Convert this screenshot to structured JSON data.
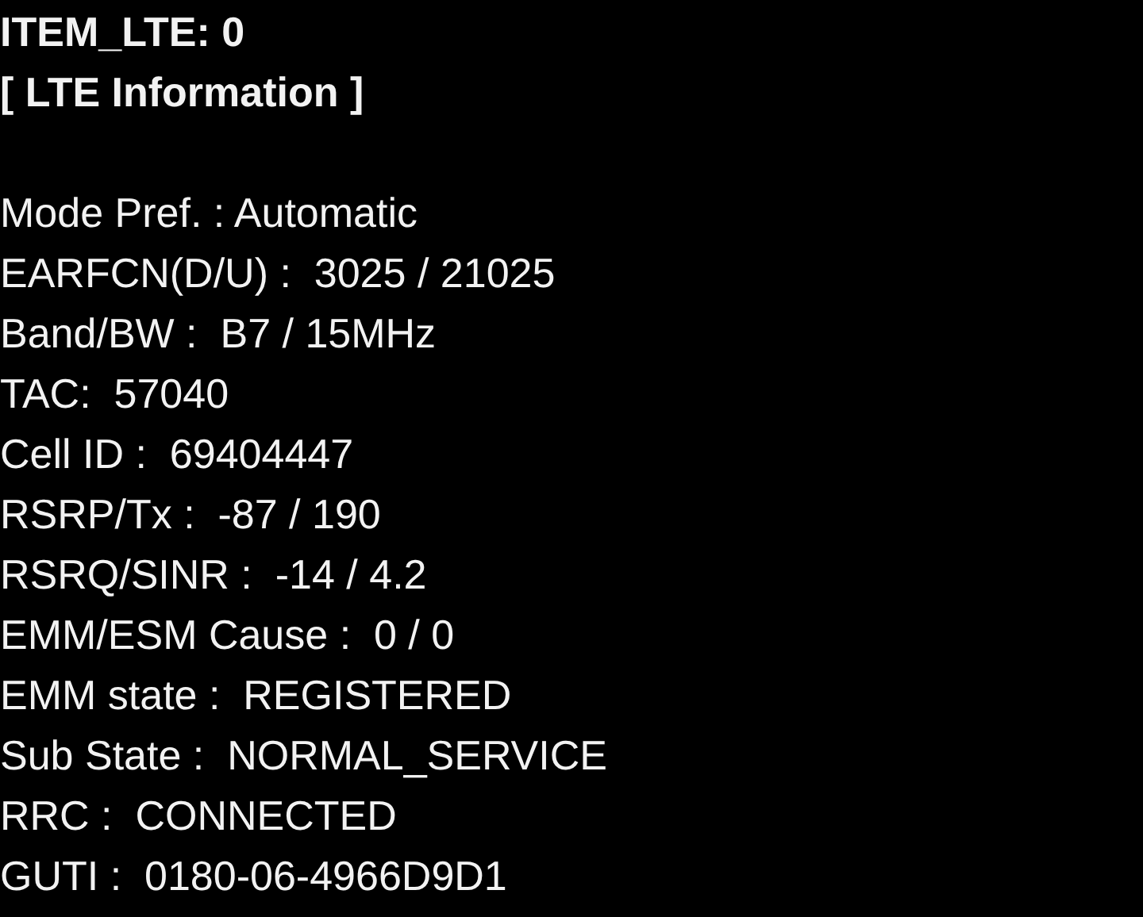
{
  "lines": [
    {
      "kind": "header",
      "text": "ITEM_LTE: 0"
    },
    {
      "kind": "header",
      "text": "[ LTE Information ]"
    },
    {
      "kind": "blank"
    },
    {
      "kind": "field",
      "text": "Mode Pref. : Automatic"
    },
    {
      "kind": "field",
      "text": "EARFCN(D/U) :  3025 / 21025"
    },
    {
      "kind": "field",
      "text": "Band/BW :  B7 / 15MHz"
    },
    {
      "kind": "field",
      "text": "TAC:  57040"
    },
    {
      "kind": "field",
      "text": "Cell ID :  69404447"
    },
    {
      "kind": "field",
      "text": "RSRP/Tx :  -87 / 190"
    },
    {
      "kind": "field",
      "text": "RSRQ/SINR :  -14 / 4.2"
    },
    {
      "kind": "field",
      "text": "EMM/ESM Cause :  0 / 0"
    },
    {
      "kind": "field",
      "text": "EMM state :  REGISTERED"
    },
    {
      "kind": "field",
      "text": "Sub State :  NORMAL_SERVICE"
    },
    {
      "kind": "field",
      "text": "RRC :  CONNECTED"
    },
    {
      "kind": "field",
      "text": "GUTI :  0180-06-4966D9D1"
    }
  ]
}
